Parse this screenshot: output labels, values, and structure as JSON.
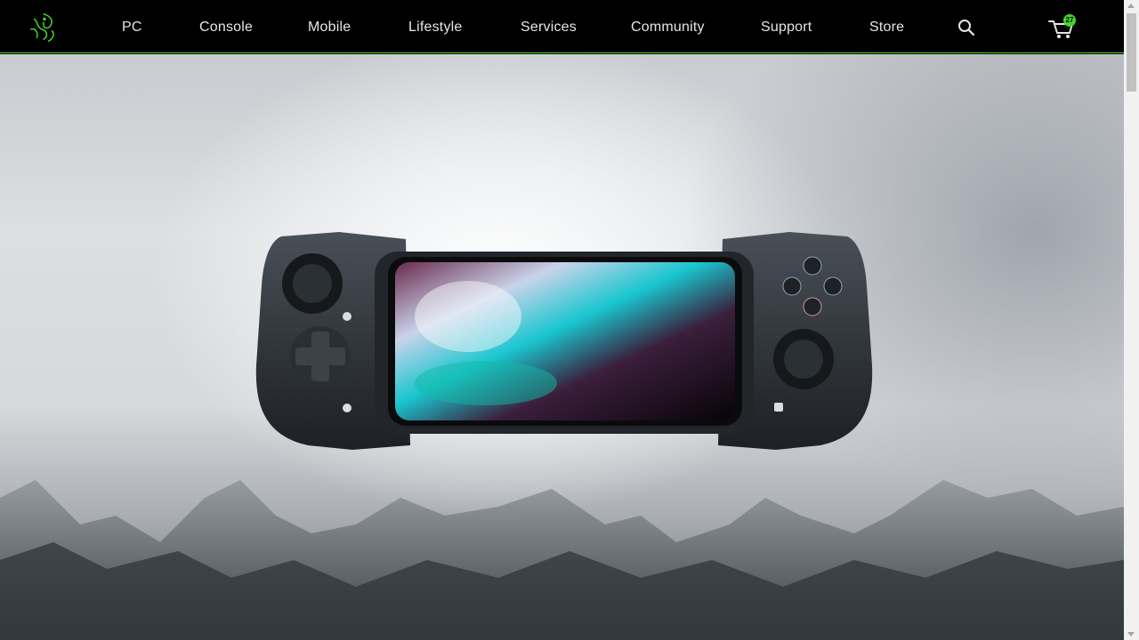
{
  "nav": {
    "items": [
      {
        "label": "PC"
      },
      {
        "label": "Console"
      },
      {
        "label": "Mobile"
      },
      {
        "label": "Lifestyle"
      },
      {
        "label": "Services"
      },
      {
        "label": "Community"
      },
      {
        "label": "Support"
      },
      {
        "label": "Store"
      }
    ],
    "cart_count": "27",
    "logo_icon": "razer-snake-icon",
    "search_icon": "search-icon",
    "cart_icon": "cart-icon"
  },
  "colors": {
    "brand_green": "#44d62c",
    "nav_bg": "#000000",
    "nav_text": "#e6e6e6"
  },
  "hero": {
    "image": "Razer Kishi mobile gaming controller with phone, over misty mountains"
  }
}
